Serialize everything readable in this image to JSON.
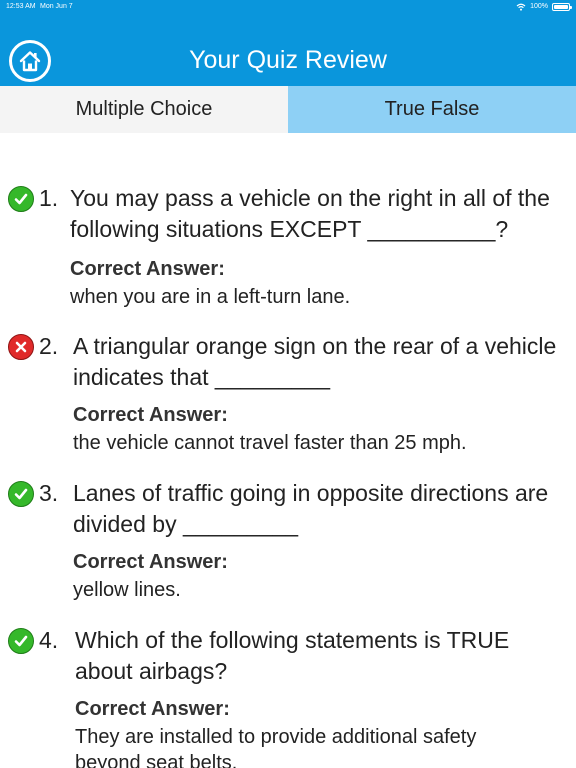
{
  "status_bar": {
    "time": "12:53 AM",
    "date": "Mon Jun 7",
    "battery": "100%",
    "battery_level": 1.0
  },
  "header": {
    "title": "Your Quiz Review",
    "home_icon": "home-icon"
  },
  "tabs": [
    {
      "label": "Multiple Choice",
      "selected": true
    },
    {
      "label": "True False",
      "selected": false
    }
  ],
  "colors": {
    "header": "#0a96dc",
    "tab_inactive": "#8ed0f5",
    "tab_active": "#f4f4f4",
    "correct": "#35b82a",
    "wrong": "#e02a2a"
  },
  "questions": [
    {
      "number": "1.",
      "status": "correct",
      "icon": "check-icon",
      "line1": "You may pass a vehicle on the right in all of the",
      "line2": "following situations EXCEPT __________?",
      "answer_label": "Correct Answer:",
      "answer": "when you are in a left-turn lane."
    },
    {
      "number": "2.",
      "status": "wrong",
      "icon": "x-icon",
      "line1": "A triangular orange sign on the rear of a vehicle",
      "line2": "indicates that _________",
      "answer_label": "Correct Answer:",
      "answer": "the vehicle cannot travel faster than 25 mph."
    },
    {
      "number": "3.",
      "status": "correct",
      "icon": "check-icon",
      "line1": "Lanes of traffic going in opposite directions are",
      "line2": "divided by _________",
      "answer_label": "Correct Answer:",
      "answer": "yellow lines."
    },
    {
      "number": "4.",
      "status": "correct",
      "icon": "check-icon",
      "line1": "Which of the following statements is TRUE",
      "line2": "about airbags?",
      "answer_label": "Correct Answer:",
      "answer_line1": "They are installed to provide additional safety",
      "answer_line2": "beyond seat belts."
    }
  ]
}
